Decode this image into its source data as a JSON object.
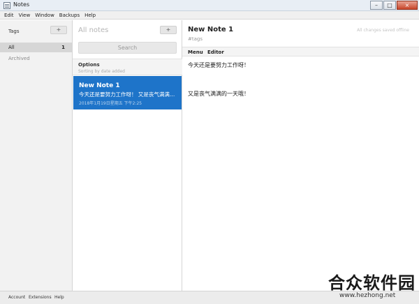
{
  "window": {
    "title": "Notes",
    "controls": [
      "–",
      "□",
      "×"
    ]
  },
  "menubar": {
    "items": [
      "Edit",
      "View",
      "Window",
      "Backups",
      "Help"
    ]
  },
  "tags": {
    "header": "Tags",
    "add_label": "+",
    "all_label": "All",
    "all_count": "1",
    "archived_label": "Archived"
  },
  "notes_list": {
    "header": "All notes",
    "add_label": "+",
    "search_placeholder": "Search",
    "options_label": "Options",
    "sort_label": "Sorting by date added",
    "items": [
      {
        "title": "New Note 1",
        "preview": "今天还是要努力工作呀！ 又是丧气满满的一天哦！",
        "date": "2018年1月19日星期五 下午2:25"
      }
    ]
  },
  "editor": {
    "title": "New Note 1",
    "tags_placeholder": "#tags",
    "status": "All changes saved offline",
    "tabs": [
      "Menu",
      "Editor"
    ],
    "lines": [
      "今天还是要努力工作呀！",
      "又是丧气满满的一天哦！"
    ]
  },
  "footer": {
    "links": [
      "Account",
      "Extensions",
      "Help"
    ]
  },
  "watermark": {
    "logo": "合众软件园",
    "url": "www.hezhong.net"
  },
  "colors": {
    "accent": "#1e74c9",
    "sidebar": "#f2f2f2",
    "selected_tag": "#d6d6d6"
  }
}
